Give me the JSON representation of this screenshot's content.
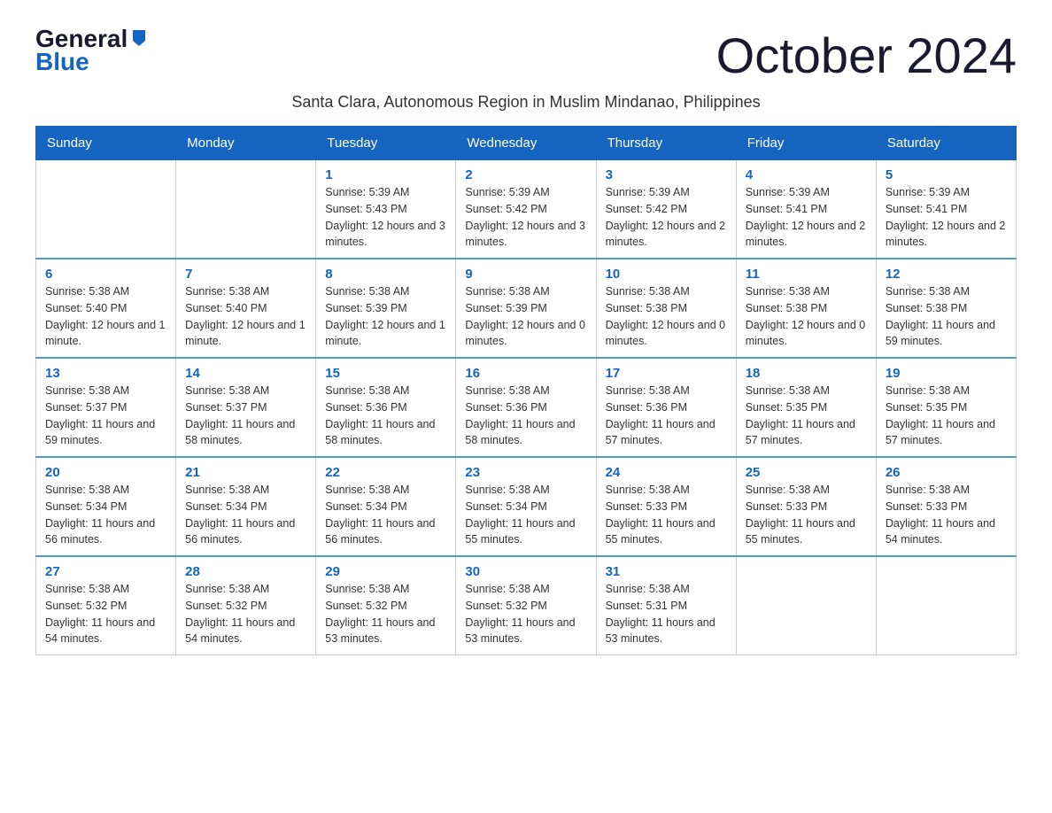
{
  "header": {
    "logo_line1": "General",
    "logo_line2": "Blue",
    "month_title": "October 2024",
    "subtitle": "Santa Clara, Autonomous Region in Muslim Mindanao, Philippines"
  },
  "weekdays": [
    "Sunday",
    "Monday",
    "Tuesday",
    "Wednesday",
    "Thursday",
    "Friday",
    "Saturday"
  ],
  "weeks": [
    [
      {
        "day": "",
        "info": ""
      },
      {
        "day": "",
        "info": ""
      },
      {
        "day": "1",
        "info": "Sunrise: 5:39 AM\nSunset: 5:43 PM\nDaylight: 12 hours\nand 3 minutes."
      },
      {
        "day": "2",
        "info": "Sunrise: 5:39 AM\nSunset: 5:42 PM\nDaylight: 12 hours\nand 3 minutes."
      },
      {
        "day": "3",
        "info": "Sunrise: 5:39 AM\nSunset: 5:42 PM\nDaylight: 12 hours\nand 2 minutes."
      },
      {
        "day": "4",
        "info": "Sunrise: 5:39 AM\nSunset: 5:41 PM\nDaylight: 12 hours\nand 2 minutes."
      },
      {
        "day": "5",
        "info": "Sunrise: 5:39 AM\nSunset: 5:41 PM\nDaylight: 12 hours\nand 2 minutes."
      }
    ],
    [
      {
        "day": "6",
        "info": "Sunrise: 5:38 AM\nSunset: 5:40 PM\nDaylight: 12 hours\nand 1 minute."
      },
      {
        "day": "7",
        "info": "Sunrise: 5:38 AM\nSunset: 5:40 PM\nDaylight: 12 hours\nand 1 minute."
      },
      {
        "day": "8",
        "info": "Sunrise: 5:38 AM\nSunset: 5:39 PM\nDaylight: 12 hours\nand 1 minute."
      },
      {
        "day": "9",
        "info": "Sunrise: 5:38 AM\nSunset: 5:39 PM\nDaylight: 12 hours\nand 0 minutes."
      },
      {
        "day": "10",
        "info": "Sunrise: 5:38 AM\nSunset: 5:38 PM\nDaylight: 12 hours\nand 0 minutes."
      },
      {
        "day": "11",
        "info": "Sunrise: 5:38 AM\nSunset: 5:38 PM\nDaylight: 12 hours\nand 0 minutes."
      },
      {
        "day": "12",
        "info": "Sunrise: 5:38 AM\nSunset: 5:38 PM\nDaylight: 11 hours\nand 59 minutes."
      }
    ],
    [
      {
        "day": "13",
        "info": "Sunrise: 5:38 AM\nSunset: 5:37 PM\nDaylight: 11 hours\nand 59 minutes."
      },
      {
        "day": "14",
        "info": "Sunrise: 5:38 AM\nSunset: 5:37 PM\nDaylight: 11 hours\nand 58 minutes."
      },
      {
        "day": "15",
        "info": "Sunrise: 5:38 AM\nSunset: 5:36 PM\nDaylight: 11 hours\nand 58 minutes."
      },
      {
        "day": "16",
        "info": "Sunrise: 5:38 AM\nSunset: 5:36 PM\nDaylight: 11 hours\nand 58 minutes."
      },
      {
        "day": "17",
        "info": "Sunrise: 5:38 AM\nSunset: 5:36 PM\nDaylight: 11 hours\nand 57 minutes."
      },
      {
        "day": "18",
        "info": "Sunrise: 5:38 AM\nSunset: 5:35 PM\nDaylight: 11 hours\nand 57 minutes."
      },
      {
        "day": "19",
        "info": "Sunrise: 5:38 AM\nSunset: 5:35 PM\nDaylight: 11 hours\nand 57 minutes."
      }
    ],
    [
      {
        "day": "20",
        "info": "Sunrise: 5:38 AM\nSunset: 5:34 PM\nDaylight: 11 hours\nand 56 minutes."
      },
      {
        "day": "21",
        "info": "Sunrise: 5:38 AM\nSunset: 5:34 PM\nDaylight: 11 hours\nand 56 minutes."
      },
      {
        "day": "22",
        "info": "Sunrise: 5:38 AM\nSunset: 5:34 PM\nDaylight: 11 hours\nand 56 minutes."
      },
      {
        "day": "23",
        "info": "Sunrise: 5:38 AM\nSunset: 5:34 PM\nDaylight: 11 hours\nand 55 minutes."
      },
      {
        "day": "24",
        "info": "Sunrise: 5:38 AM\nSunset: 5:33 PM\nDaylight: 11 hours\nand 55 minutes."
      },
      {
        "day": "25",
        "info": "Sunrise: 5:38 AM\nSunset: 5:33 PM\nDaylight: 11 hours\nand 55 minutes."
      },
      {
        "day": "26",
        "info": "Sunrise: 5:38 AM\nSunset: 5:33 PM\nDaylight: 11 hours\nand 54 minutes."
      }
    ],
    [
      {
        "day": "27",
        "info": "Sunrise: 5:38 AM\nSunset: 5:32 PM\nDaylight: 11 hours\nand 54 minutes."
      },
      {
        "day": "28",
        "info": "Sunrise: 5:38 AM\nSunset: 5:32 PM\nDaylight: 11 hours\nand 54 minutes."
      },
      {
        "day": "29",
        "info": "Sunrise: 5:38 AM\nSunset: 5:32 PM\nDaylight: 11 hours\nand 53 minutes."
      },
      {
        "day": "30",
        "info": "Sunrise: 5:38 AM\nSunset: 5:32 PM\nDaylight: 11 hours\nand 53 minutes."
      },
      {
        "day": "31",
        "info": "Sunrise: 5:38 AM\nSunset: 5:31 PM\nDaylight: 11 hours\nand 53 minutes."
      },
      {
        "day": "",
        "info": ""
      },
      {
        "day": "",
        "info": ""
      }
    ]
  ]
}
